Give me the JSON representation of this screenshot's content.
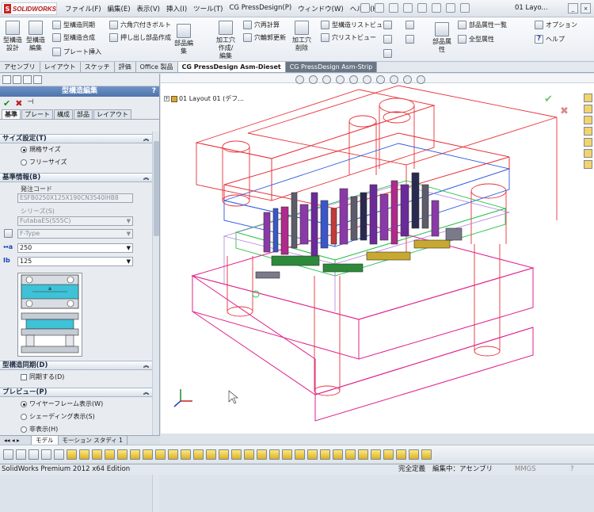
{
  "app": {
    "logo_text": "SOLIDWORKS",
    "window_title": "01 Layo...",
    "menu": [
      "ファイル(F)",
      "編集(E)",
      "表示(V)",
      "挿入(I)",
      "ツール(T)",
      "CG PressDesign(P)",
      "ウィンドウ(W)",
      "ヘルプ(H)"
    ]
  },
  "ribbon": {
    "big_buttons": [
      {
        "label": "型構造\n設計"
      },
      {
        "label": "型構造\n編集"
      },
      {
        "label": "部品編\n集"
      },
      {
        "label": "加工穴\n作成/\n編集"
      },
      {
        "label": "加工穴\n削除"
      },
      {
        "label": "部品属\n性"
      }
    ],
    "small_buttons": [
      "型構造同期",
      "型構造合成",
      "プレート挿入",
      "六角穴付きボルト",
      "押し出し部品作成",
      "穴再計算",
      "穴輪郭更新",
      "型構造リストビュー",
      "穴リストビュー",
      "部品属性一覧",
      "全型属性",
      "オプション",
      "ヘルプ"
    ]
  },
  "doc_tabs": [
    {
      "label": "アセンブリ"
    },
    {
      "label": "レイアウト"
    },
    {
      "label": "スケッチ"
    },
    {
      "label": "評価"
    },
    {
      "label": "Office 製品"
    },
    {
      "label": "CG PressDesign Asm-Dieset"
    },
    {
      "label": "CG PressDesign Asm-Strip"
    }
  ],
  "property_manager": {
    "title": "型構造編集",
    "help": "?",
    "ok_symbol": "✔",
    "cancel_symbol": "✖",
    "pin_symbol": "⊣",
    "subtabs": [
      "基準",
      "プレート",
      "構成",
      "部品",
      "レイアウト"
    ],
    "size_section": {
      "title": "サイズ設定(T)",
      "options": [
        "規格サイズ",
        "フリーサイズ"
      ],
      "selected": "規格サイズ"
    },
    "base_section": {
      "title": "基準情報(B)",
      "order_code_label": "発注コード",
      "order_code": "ESFB0250X125X190CN3540IHB8",
      "series_label": "シリーズ(S)",
      "series_value": "FutabaES(S55C)",
      "type_value": "F-Type",
      "size_a": "250",
      "size_b": "125",
      "dim_label": "a"
    },
    "sync_section": {
      "title": "型構造同期(D)",
      "checkbox_label": "同期する(D)"
    },
    "preview_section": {
      "title": "プレビュー(P)",
      "options": [
        "ワイヤーフレーム表示(W)",
        "シェーディング表示(S)",
        "非表示(H)"
      ],
      "selected": "ワイヤーフレーム表示(W)"
    }
  },
  "bottom_tabs": [
    "モデル",
    "モーション スタディ 1"
  ],
  "viewport": {
    "tree_label": "01 Layout 01 (デフ..."
  },
  "status": {
    "edition": "SolidWorks Premium 2012 x64 Edition",
    "state": "完全定義",
    "editing": "編集中：アセンブリ",
    "units": "MMGS",
    "help": "?"
  },
  "colors": {
    "pm_header": "#5579b1",
    "ok": "#1c8a20",
    "cancel": "#c0201f",
    "wire_red": "#e8323a",
    "wire_pink": "#e0208c",
    "wire_blue": "#2b5be0",
    "wire_green": "#28c24a"
  }
}
